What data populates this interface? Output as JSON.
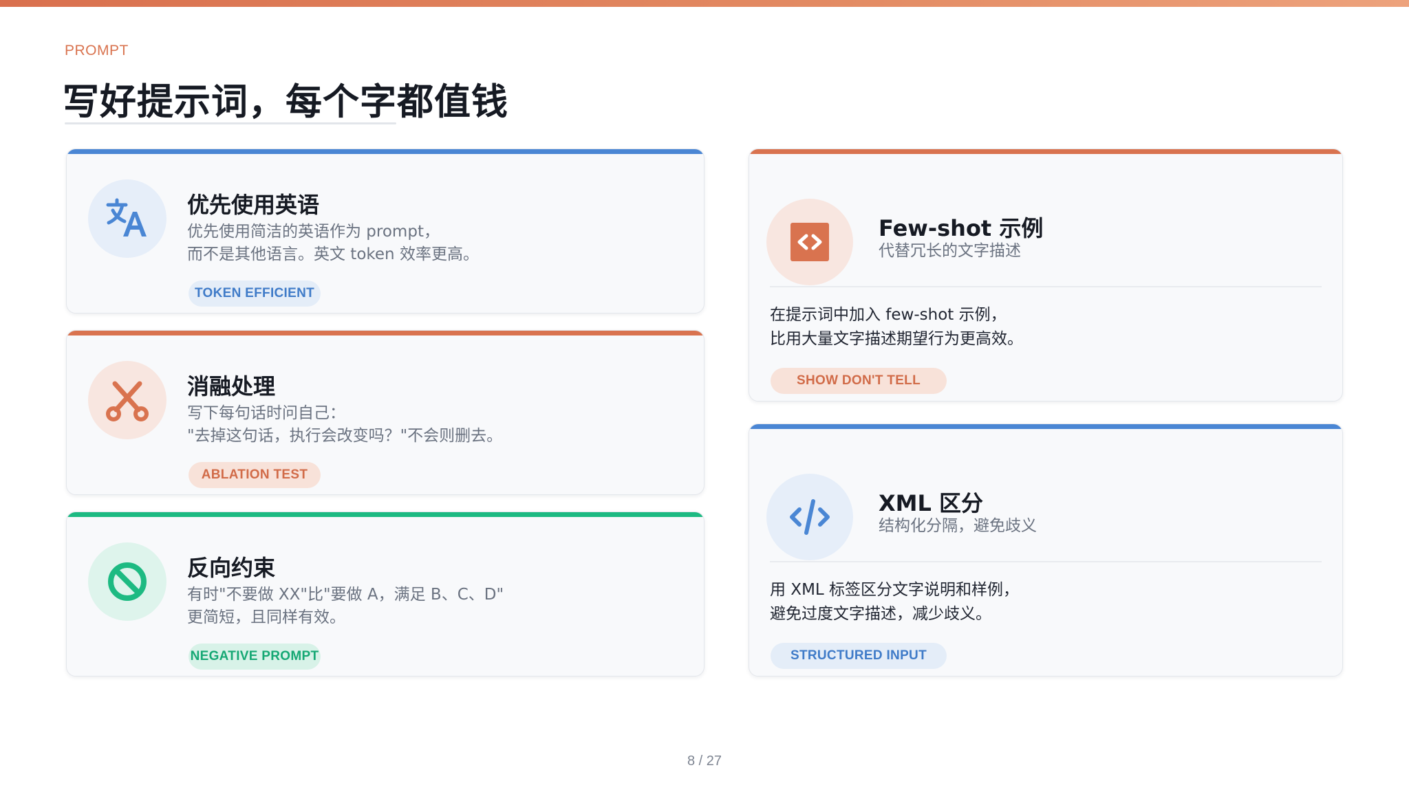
{
  "header": {
    "eyebrow": "PROMPT",
    "title": "写好提示词，每个字都值钱"
  },
  "colors": {
    "blue": "#4a86d4",
    "orange": "#d9734f",
    "green": "#1dba82",
    "card_bg": "#f8f9fb"
  },
  "left_cards": [
    {
      "icon": "translate-icon",
      "title": "优先使用英语",
      "desc_line1": "优先使用简洁的英语作为 prompt，",
      "desc_line2": "而不是其他语言。英文 token 效率更高。",
      "badge": "TOKEN EFFICIENT",
      "accent": "#4a86d4"
    },
    {
      "icon": "scissors-icon",
      "title": "消融处理",
      "desc_line1": "写下每句话时问自己：",
      "desc_line2": "\"去掉这句话，执行会改变吗？\"不会则删去。",
      "badge": "ABLATION TEST",
      "accent": "#d9734f"
    },
    {
      "icon": "prohibited-icon",
      "title": "反向约束",
      "desc_line1": "有时\"不要做 XX\"比\"要做 A，满足 B、C、D\"",
      "desc_line2": "更简短，且同样有效。",
      "badge": "NEGATIVE PROMPT",
      "accent": "#1dba82"
    }
  ],
  "right_cards": [
    {
      "icon": "code-icon",
      "title": "Few-shot 示例",
      "subtitle": "代替冗长的文字描述",
      "body_line1": "在提示词中加入 few-shot 示例，",
      "body_line2": "比用大量文字描述期望行为更高效。",
      "badge": "SHOW DON'T TELL",
      "accent": "#d9734f"
    },
    {
      "icon": "code-slash-icon",
      "title": "XML 区分",
      "subtitle": "结构化分隔，避免歧义",
      "body_line1": "用 XML 标签区分文字说明和样例，",
      "body_line2": "避免过度文字描述，减少歧义。",
      "badge": "STRUCTURED INPUT",
      "accent": "#4a86d4"
    }
  ],
  "footer": {
    "page": "8 / 27"
  }
}
